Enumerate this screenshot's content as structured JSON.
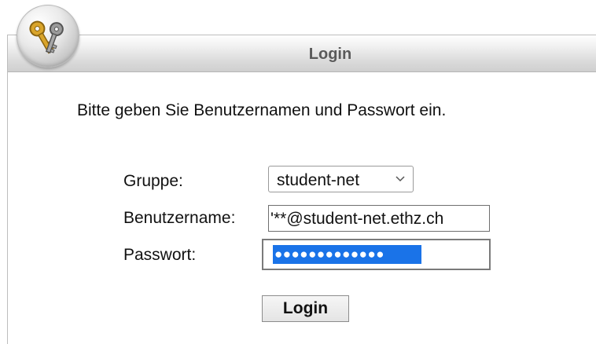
{
  "header": {
    "title": "Login"
  },
  "form": {
    "instruction": "Bitte geben Sie Benutzernamen und Passwort ein.",
    "group_label": "Gruppe:",
    "group_value": "student-net",
    "username_label": "Benutzername:",
    "username_value": "'**@student-net.ethz.ch",
    "password_label": "Passwort:",
    "password_dots": "●●●●●●●●●●●●●",
    "submit_label": "Login"
  },
  "icons": {
    "logo": "keys-icon",
    "select_arrow": "chevron-down-icon"
  },
  "colors": {
    "selection": "#1a73e8",
    "header_text": "#5a5a5a"
  }
}
